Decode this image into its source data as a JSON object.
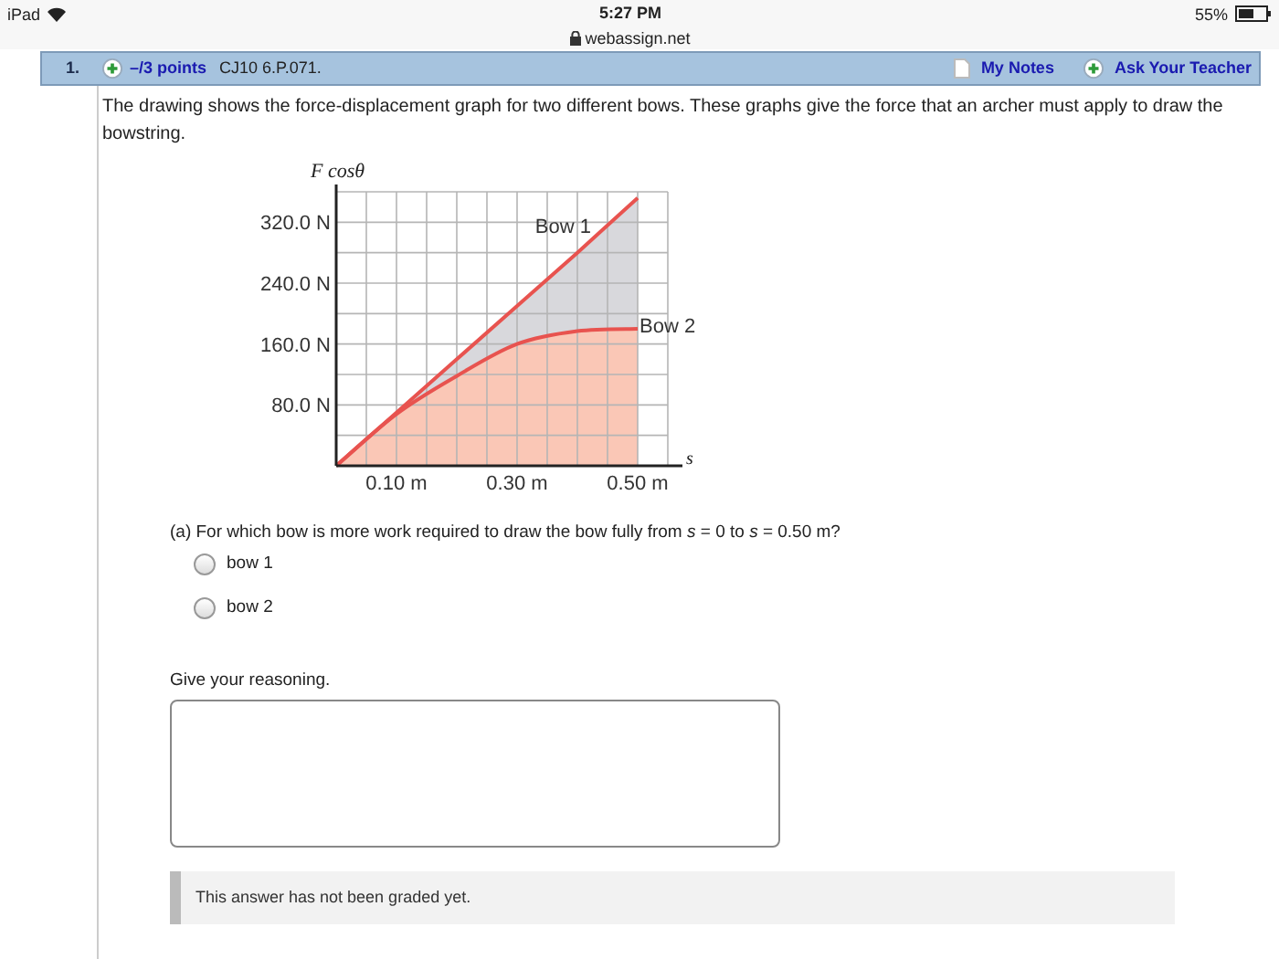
{
  "status_bar": {
    "device": "iPad",
    "time": "5:27 PM",
    "url": "webassign.net",
    "battery": "55%"
  },
  "question": {
    "number": "1.",
    "points": "–/3 points",
    "code": "CJ10 6.P.071.",
    "links": [
      "My Notes",
      "Ask Your Teacher"
    ],
    "text": "The drawing shows the force-displacement graph for two different bows. These graphs give the force that an archer must apply to draw the bowstring.",
    "chart_data": {
      "type": "line",
      "ylabel": "F cosθ",
      "xlabel": "s",
      "x": [
        0,
        0.1,
        0.2,
        0.3,
        0.4,
        0.5
      ],
      "series": [
        {
          "name": "Bow 1",
          "color": "#e8534f",
          "values": [
            0,
            70,
            140,
            210,
            280,
            352
          ]
        },
        {
          "name": "Bow 2",
          "color": "#e8534f",
          "values": [
            0,
            68,
            118,
            160,
            177,
            180
          ]
        }
      ],
      "xlim": [
        0,
        0.55
      ],
      "ylim": [
        0,
        360
      ],
      "grid": true,
      "xticks": [
        {
          "value": 0.1,
          "label": "0.10 m"
        },
        {
          "value": 0.3,
          "label": "0.30 m"
        },
        {
          "value": 0.5,
          "label": "0.50 m"
        }
      ],
      "yticks": [
        {
          "value": 80,
          "label": "80.0 N"
        },
        {
          "value": 160,
          "label": "160.0 N"
        },
        {
          "value": 240,
          "label": "240.0 N"
        },
        {
          "value": 320,
          "label": "320.0 N"
        }
      ]
    },
    "part_a": {
      "prompt": "(a) For which bow is more work required to draw the bow fully from *s* = 0 to *s* = 0.50 m?",
      "options": [
        {
          "label": "bow 1",
          "selected": false
        },
        {
          "label": "bow 2",
          "selected": false
        }
      ],
      "reasoning_label": "Give your reasoning.",
      "grade_note": "This answer has not been graded yet."
    }
  }
}
